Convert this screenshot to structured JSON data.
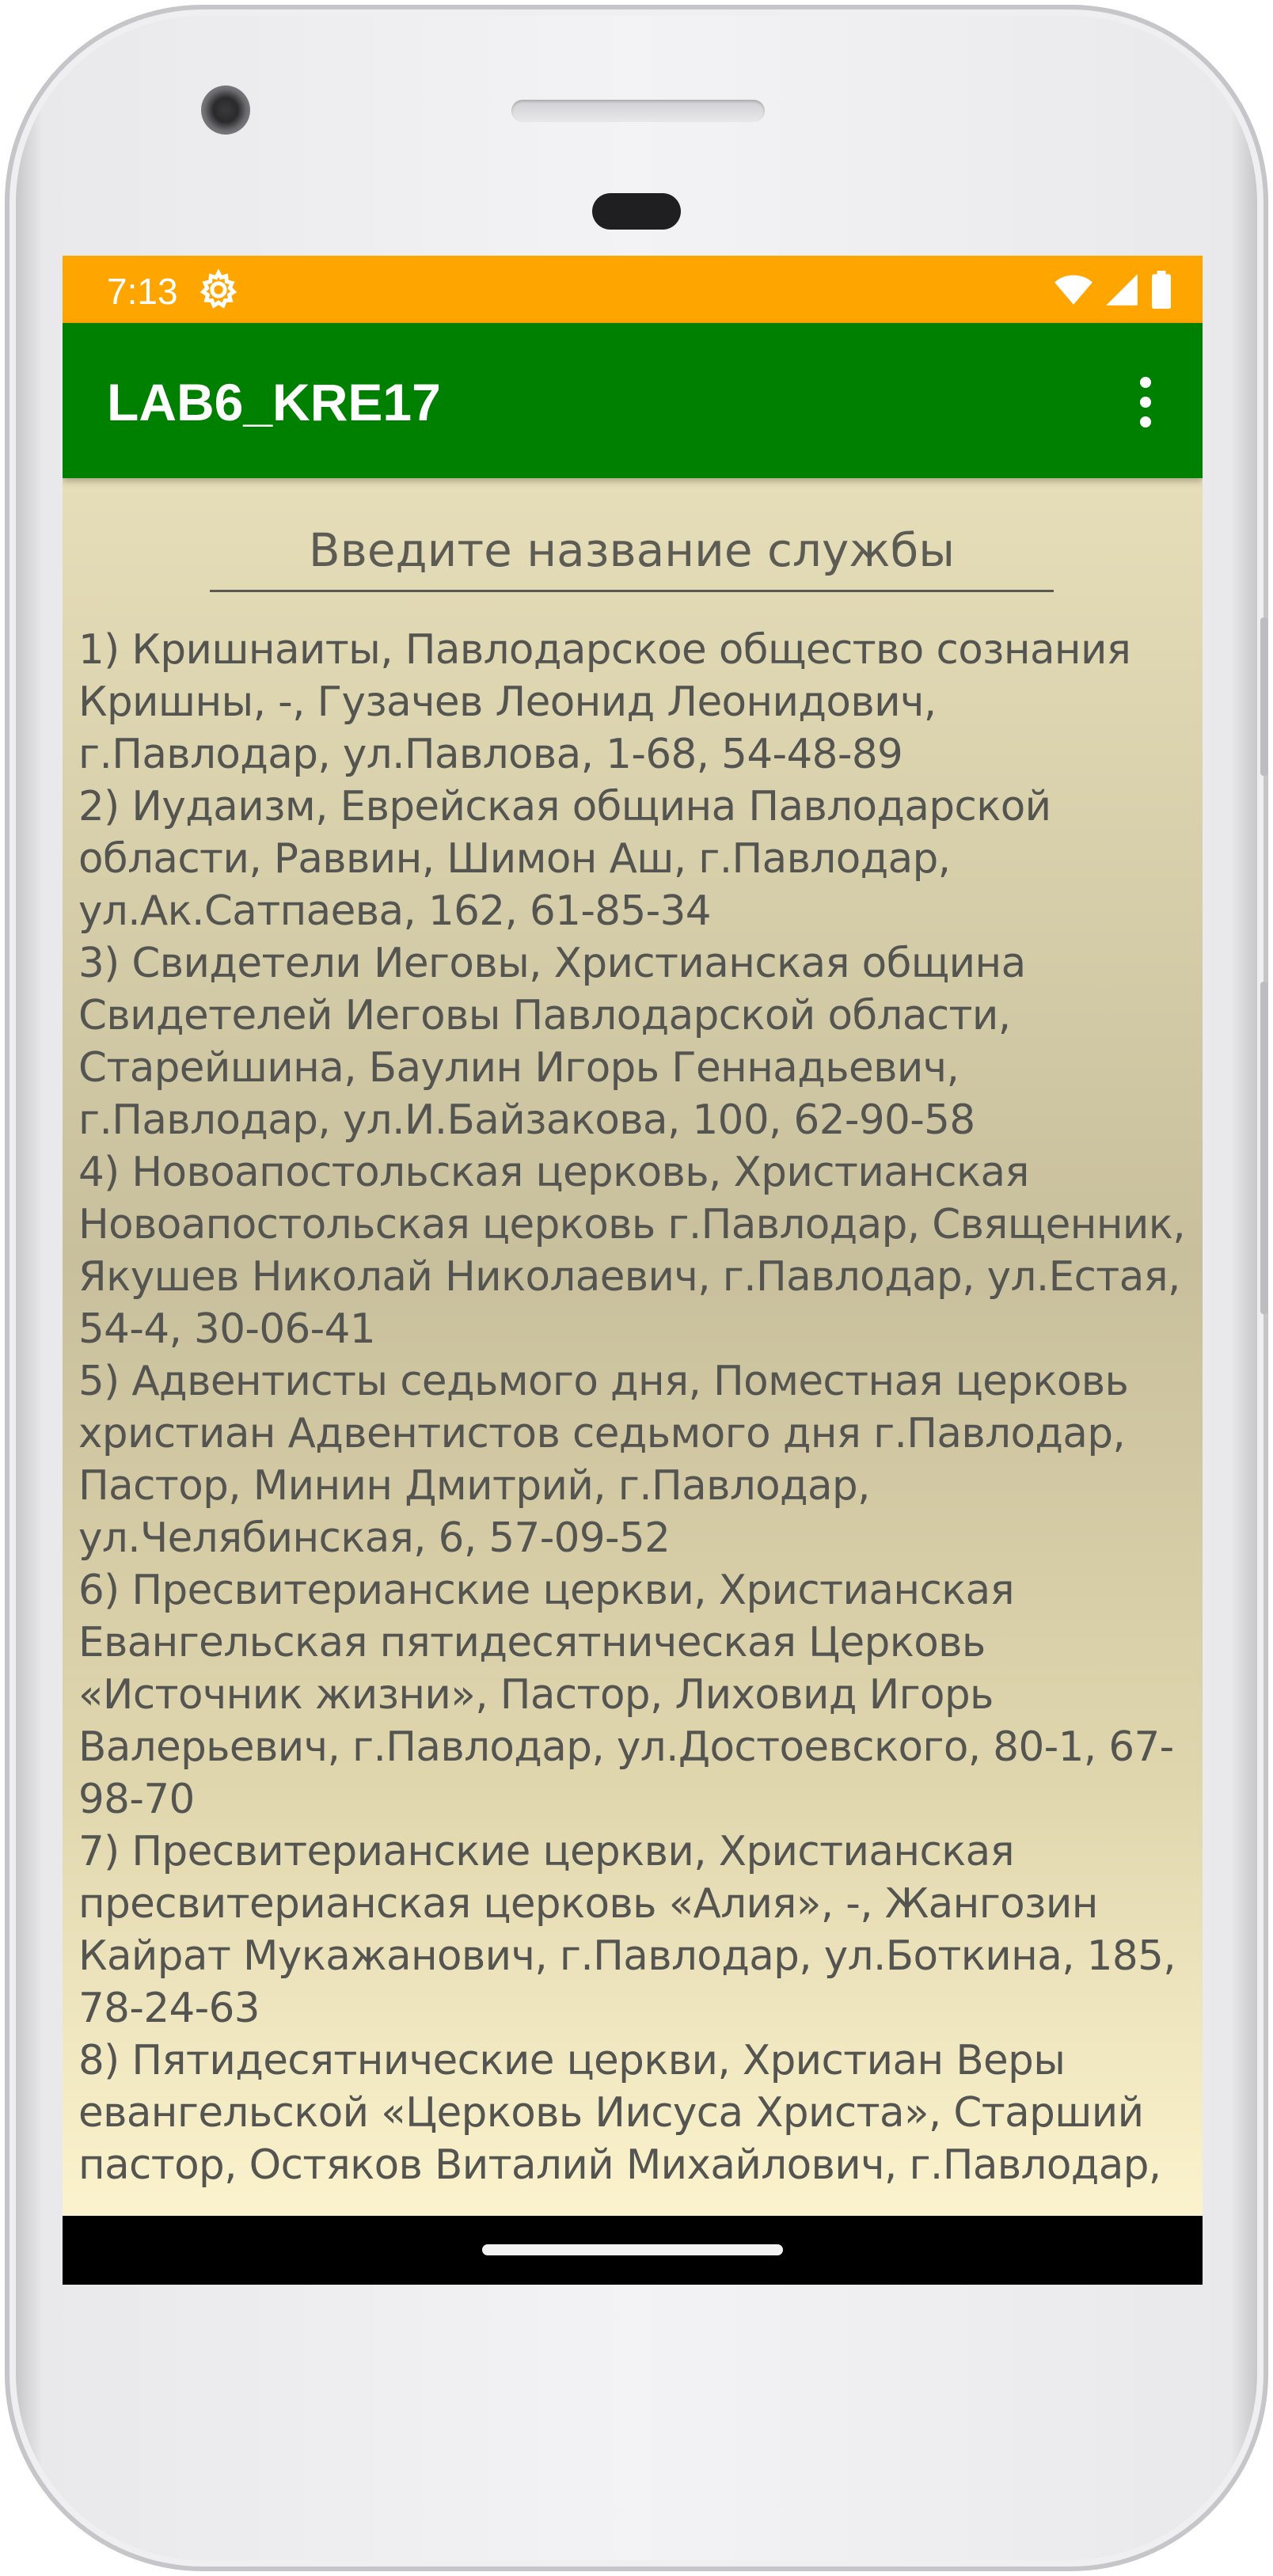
{
  "status_bar": {
    "time": "7:13",
    "icons": [
      "settings-gear-icon",
      "wifi-icon",
      "signal-icon",
      "battery-icon"
    ],
    "background_color": "#FFA500"
  },
  "app_bar": {
    "title": "LAB6_KRE17",
    "menu_icon": "more-vert-icon",
    "background_color": "#008000"
  },
  "search": {
    "placeholder": "Введите название службы",
    "value": ""
  },
  "list": {
    "items": [
      "1) Кришнаиты, Павлодарское общество сознания Кришны, -, Гузачев Леонид Леонидович, г.Павлодар, ул.Павлова, 1-68, 54-48-89",
      "2) Иудаизм, Еврейская община Павлодарской области, Раввин, Шимон Аш, г.Павлодар, ул.Ак.Сатпаева, 162, 61-85-34",
      "3) Свидетели Иеговы, Христианская община Свидетелей Иеговы Павлодарской области, Старейшина, Баулин Игорь Геннадьевич, г.Павлодар, ул.И.Байзакова, 100, 62-90-58",
      "4) Новоапостольская церковь, Христианская Новоапостольская церковь г.Павлодар, Священник, Якушев Николай Николаевич, г.Павлодар, ул.Естая, 54-4, 30-06-41",
      "5) Адвентисты седьмого дня, Поместная церковь христиан Адвентистов седьмого дня г.Павлодар, Пастор, Минин Дмитрий, г.Павлодар, ул.Челябинская, 6, 57-09-52",
      "6) Пресвитерианские церкви, Христианская Евангельская пятидесятническая Церковь «Источник жизни», Пастор, Лиховид Игорь Валерьевич, г.Павлодар, ул.Достоевского, 80-1, 67-98-70",
      "7) Пресвитерианские церкви, Христианская пресвитерианская церковь «Алия», -, Жангозин Кайрат Мукажанович, г.Павлодар, ул.Боткина, 185, 78-24-63",
      "8) Пятидесятнические церкви, Христиан Веры евангельской «Церковь Иисуса Христа», Старший пастор, Остяков Виталий Михайлович, г.Павлодар,"
    ]
  },
  "nav_bar": {
    "home_handle": "home-gesture-pill"
  }
}
